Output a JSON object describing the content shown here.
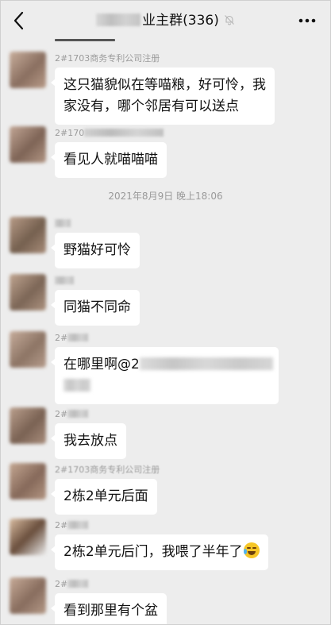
{
  "header": {
    "title": "业主群(336)",
    "back_icon": "chevron-left-icon",
    "mute_icon": "bell-muted-icon",
    "more_icon": "more-dots-icon"
  },
  "timestamp": "2021年8月9日 晚上18:06",
  "messages": [
    {
      "sender": "2#1703商务专利公司注册",
      "lines": [
        "这只猫貌似在等喵粮，好可怜，我",
        "家没有，哪个邻居有可以送点"
      ],
      "avatar_colors": [
        "#b79a86",
        "#8a6f60"
      ]
    },
    {
      "sender": "2#170",
      "lines": [
        "看见人就喵喵喵"
      ],
      "avatar_colors": [
        "#b09483",
        "#7e6456"
      ]
    },
    {
      "sender": "",
      "lines": [
        "野猫好可怜"
      ],
      "avatar_colors": [
        "#a58b78",
        "#75604f"
      ]
    },
    {
      "sender": "",
      "lines": [
        "同猫不同命"
      ],
      "avatar_colors": [
        "#ad9380",
        "#7c6656"
      ]
    },
    {
      "sender": "2#",
      "lines": [
        "在哪里啊@2"
      ],
      "avatar_colors": [
        "#b69c8c",
        "#8d7565"
      ]
    },
    {
      "sender": "2#",
      "lines": [
        "我去放点"
      ],
      "avatar_colors": [
        "#a98e7d",
        "#7a6253"
      ]
    },
    {
      "sender": "2#1703商务专利公司注册",
      "lines": [
        "2栋2单元后面"
      ],
      "avatar_colors": [
        "#b39683",
        "#86695a"
      ]
    },
    {
      "sender": "2#",
      "lines": [
        "2栋2单元后门，我喂了半年了"
      ],
      "emoji": "laughing-tears-emoji",
      "avatar_colors": [
        "#c9a98f",
        "#6a4f3d"
      ]
    },
    {
      "sender": "2#",
      "lines": [
        "看到那里有个盆"
      ],
      "avatar_colors": [
        "#b59a88",
        "#886d5e"
      ]
    }
  ]
}
